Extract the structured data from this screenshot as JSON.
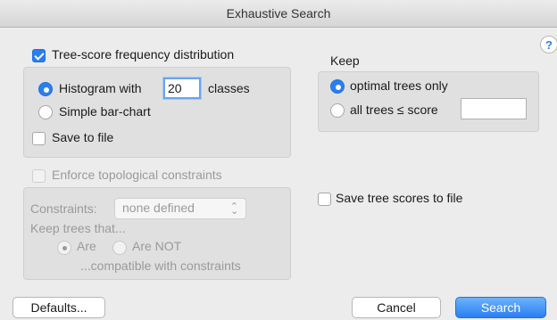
{
  "window": {
    "title": "Exhaustive Search"
  },
  "help": {
    "label": "?"
  },
  "freq": {
    "checkbox_label": "Tree-score frequency distribution",
    "histogram_label": "Histogram with",
    "classes_value": "20",
    "classes_label": "classes",
    "barchart_label": "Simple bar-chart",
    "save_label": "Save to file"
  },
  "keep": {
    "title": "Keep",
    "optimal_label": "optimal trees only",
    "all_label": "all trees ≤ score",
    "score_value": ""
  },
  "constraints": {
    "enforce_label": "Enforce topological constraints",
    "constraints_label": "Constraints:",
    "constraints_value": "none defined",
    "keep_label": "Keep trees that...",
    "are_label": "Are",
    "arenot_label": "Are NOT",
    "compatible_label": "...compatible with constraints"
  },
  "save_scores_label": "Save tree scores to file",
  "buttons": {
    "defaults": "Defaults...",
    "cancel": "Cancel",
    "search": "Search"
  }
}
